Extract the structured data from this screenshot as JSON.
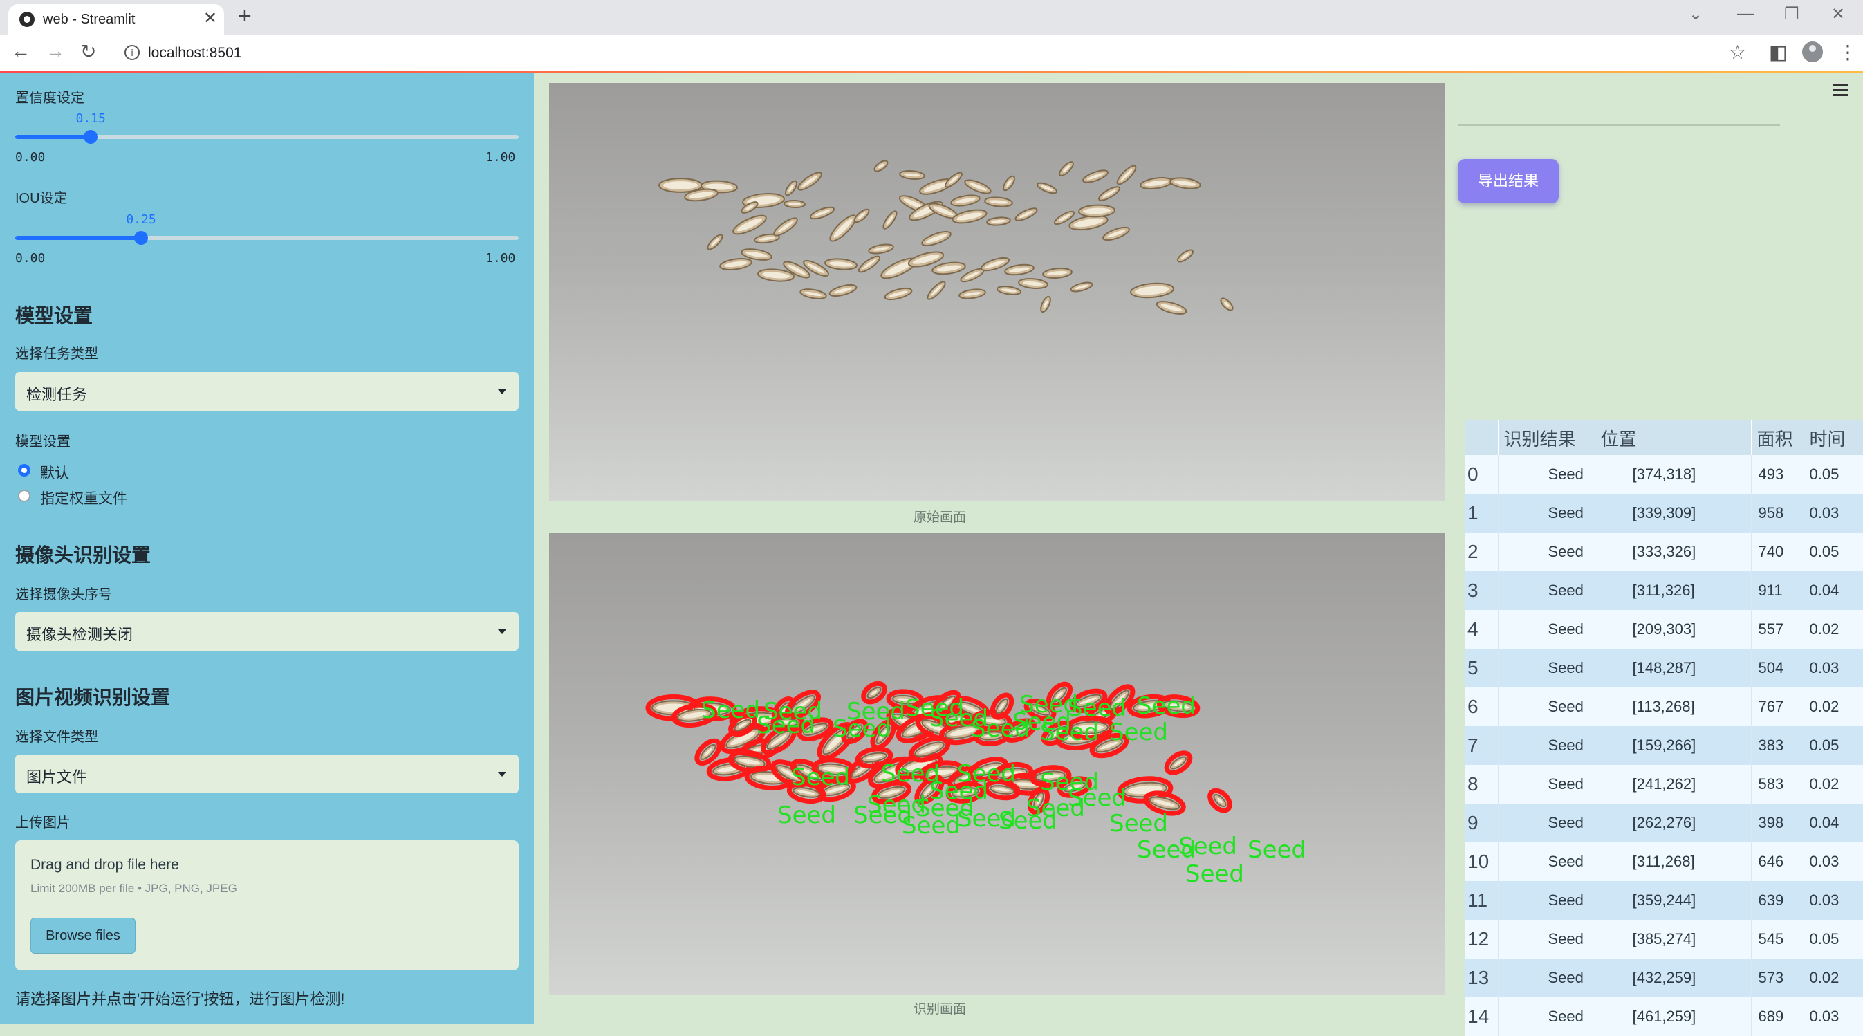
{
  "browser": {
    "tab_title": "web - Streamlit",
    "url": "localhost:8501"
  },
  "sidebar": {
    "confidence": {
      "label": "置信度设定",
      "value": "0.15",
      "min": "0.00",
      "max": "1.00",
      "fraction": 0.15
    },
    "iou": {
      "label": "IOU设定",
      "value": "0.25",
      "min": "0.00",
      "max": "1.00",
      "fraction": 0.25
    },
    "model_section": {
      "heading": "模型设置",
      "task_label": "选择任务类型",
      "task_value": "检测任务",
      "model_label": "模型设置",
      "options": [
        "默认",
        "指定权重文件"
      ],
      "selected": 0
    },
    "camera_section": {
      "heading": "摄像头识别设置",
      "camera_label": "选择摄像头序号",
      "camera_value": "摄像头检测关闭"
    },
    "media_section": {
      "heading": "图片视频识别设置",
      "filetype_label": "选择文件类型",
      "filetype_value": "图片文件",
      "upload_label": "上传图片",
      "dropzone_title": "Drag and drop file here",
      "dropzone_limit": "Limit 200MB per file • JPG, PNG, JPEG",
      "browse_label": "Browse files"
    },
    "footer_hint": "请选择图片并点击'开始运行'按钮，进行图片检测!"
  },
  "main": {
    "original_caption": "原始画面",
    "result_caption": "识别画面",
    "detection_label": "Seed",
    "colors": {
      "box": "#ff1a1a",
      "label": "#22e022"
    }
  },
  "right": {
    "export_label": "导出结果",
    "table": {
      "headers": [
        "",
        "识别结果",
        "位置",
        "面积",
        "时间"
      ],
      "rows": [
        [
          "0",
          "Seed",
          "[374,318]",
          "493",
          "0.05"
        ],
        [
          "1",
          "Seed",
          "[339,309]",
          "958",
          "0.03"
        ],
        [
          "2",
          "Seed",
          "[333,326]",
          "740",
          "0.05"
        ],
        [
          "3",
          "Seed",
          "[311,326]",
          "911",
          "0.04"
        ],
        [
          "4",
          "Seed",
          "[209,303]",
          "557",
          "0.02"
        ],
        [
          "5",
          "Seed",
          "[148,287]",
          "504",
          "0.03"
        ],
        [
          "6",
          "Seed",
          "[113,268]",
          "767",
          "0.02"
        ],
        [
          "7",
          "Seed",
          "[159,266]",
          "383",
          "0.05"
        ],
        [
          "8",
          "Seed",
          "[241,262]",
          "583",
          "0.02"
        ],
        [
          "9",
          "Seed",
          "[262,276]",
          "398",
          "0.04"
        ],
        [
          "10",
          "Seed",
          "[311,268]",
          "646",
          "0.03"
        ],
        [
          "11",
          "Seed",
          "[359,244]",
          "639",
          "0.03"
        ],
        [
          "12",
          "Seed",
          "[385,274]",
          "545",
          "0.05"
        ],
        [
          "13",
          "Seed",
          "[432,259]",
          "573",
          "0.02"
        ],
        [
          "14",
          "Seed",
          "[461,259]",
          "689",
          "0.03"
        ]
      ]
    }
  }
}
